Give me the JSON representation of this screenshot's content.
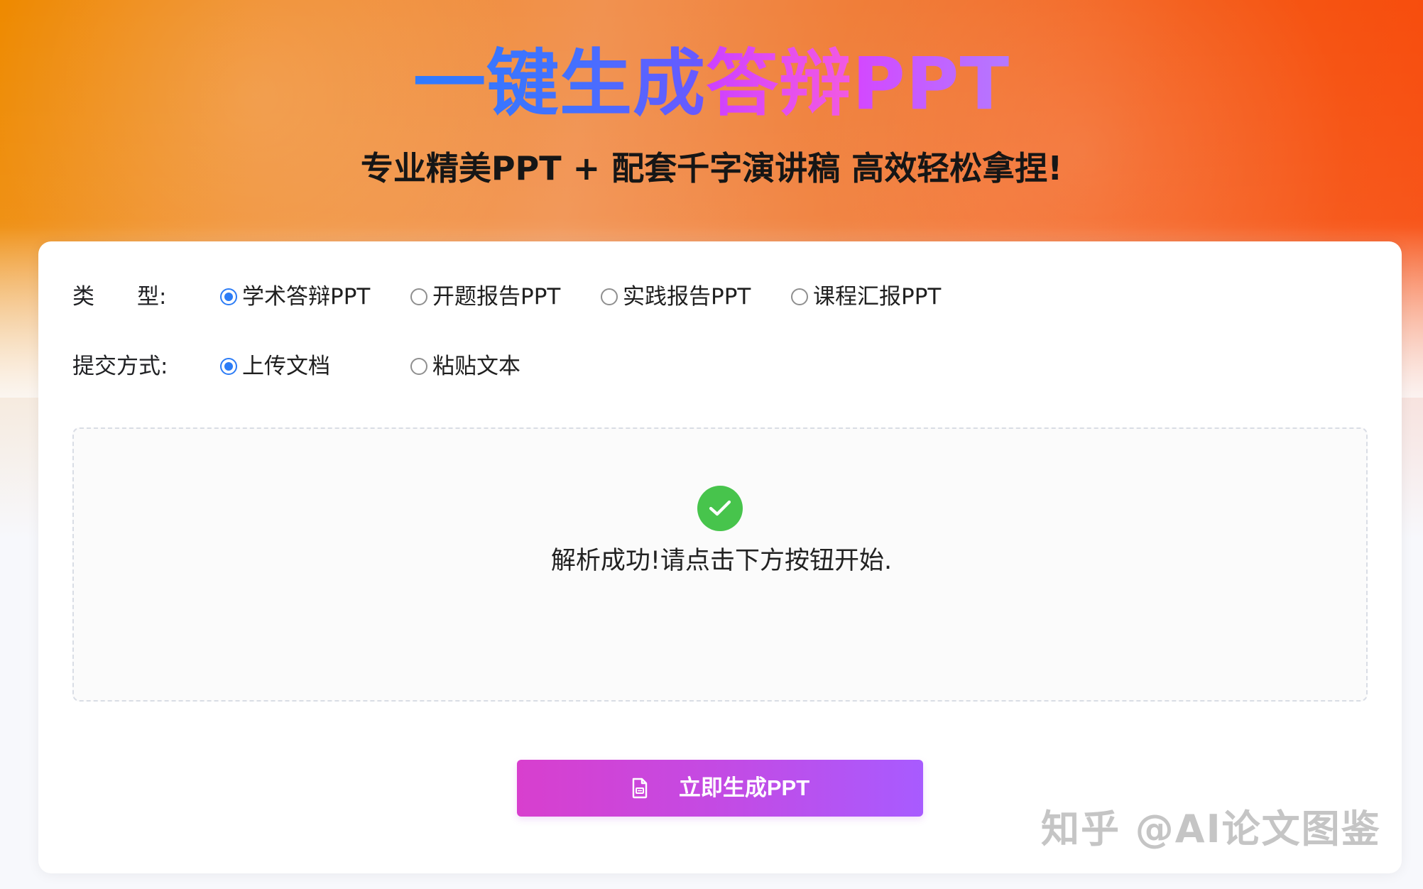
{
  "hero": {
    "title_parts": [
      "一键生成",
      "答辩",
      "PPT"
    ],
    "subtitle": "专业精美PPT + 配套千字演讲稿 高效轻松拿捏!"
  },
  "form": {
    "type": {
      "label_first": "类",
      "label_last": "型:",
      "options": [
        "学术答辩PPT",
        "开题报告PPT",
        "实践报告PPT",
        "课程汇报PPT"
      ],
      "selected": "学术答辩PPT"
    },
    "submit_method": {
      "label": "提交方式:",
      "options": [
        "上传文档",
        "粘贴文本"
      ],
      "selected": "上传文档"
    }
  },
  "upload": {
    "status_text": "解析成功!请点击下方按钮开始.",
    "status_icon": "check-circle-icon",
    "status_color": "#47c44c"
  },
  "action": {
    "generate_label": "立即生成PPT",
    "icon": "document-icon"
  },
  "watermark": {
    "text": "知乎 @AI论文图鉴"
  },
  "colors": {
    "accent_blue": "#2c7cf6",
    "title_blue": "#2f78ff",
    "title_magenta": "#d93df5",
    "button_start": "#d83fce",
    "button_end": "#a85bff",
    "header_orange": "#f45b17"
  }
}
